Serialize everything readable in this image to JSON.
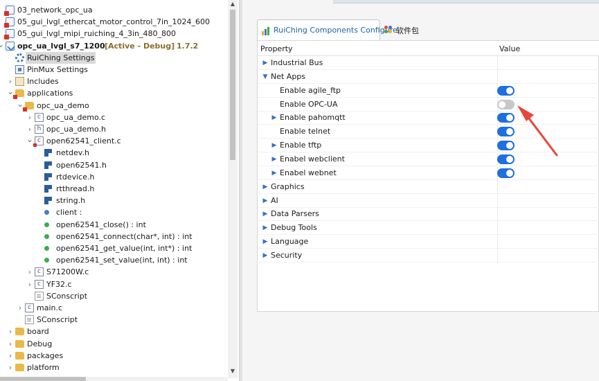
{
  "tree": [
    {
      "label": "03_network_opc_ua",
      "depth": 0,
      "expander": "",
      "icon": "projr"
    },
    {
      "label": "05_gui_lvgl_ethercat_motor_control_7in_1024_600",
      "depth": 0,
      "expander": "",
      "icon": "projr"
    },
    {
      "label": "05_gui_lvgl_mipi_ruiching_4_3in_480_800",
      "depth": 0,
      "expander": "",
      "icon": "projr"
    },
    {
      "label": "opc_ua_lvgl_s7_1200",
      "depth": 0,
      "expander": "open",
      "icon": "proj",
      "bold": true,
      "badge": "[Active - Debug]",
      "version": "1.7.2"
    },
    {
      "label": "RuiChing Settings",
      "depth": 1,
      "expander": "",
      "icon": "gear",
      "selected": true
    },
    {
      "label": "PinMux Settings",
      "depth": 1,
      "expander": "",
      "icon": "chip"
    },
    {
      "label": "Includes",
      "depth": 1,
      "expander": "closed",
      "icon": "inc"
    },
    {
      "label": "applications",
      "depth": 1,
      "expander": "open",
      "icon": "folderr"
    },
    {
      "label": "opc_ua_demo",
      "depth": 2,
      "expander": "open",
      "icon": "folderr"
    },
    {
      "label": "opc_ua_demo.c",
      "depth": 3,
      "expander": "closed",
      "icon": "file",
      "glyph": "c"
    },
    {
      "label": "opc_ua_demo.h",
      "depth": 3,
      "expander": "closed",
      "icon": "file",
      "glyph": "h"
    },
    {
      "label": "open62541_client.c",
      "depth": 3,
      "expander": "open",
      "icon": "filer",
      "glyph": "c"
    },
    {
      "label": "netdev.h",
      "depth": 4,
      "expander": "",
      "icon": "hdr"
    },
    {
      "label": "open62541.h",
      "depth": 4,
      "expander": "",
      "icon": "hdr"
    },
    {
      "label": "rtdevice.h",
      "depth": 4,
      "expander": "",
      "icon": "hdr"
    },
    {
      "label": "rtthread.h",
      "depth": 4,
      "expander": "",
      "icon": "hdr"
    },
    {
      "label": "string.h",
      "depth": 4,
      "expander": "",
      "icon": "hdr"
    },
    {
      "label": "client :",
      "depth": 4,
      "expander": "",
      "icon": "var"
    },
    {
      "label": "open62541_close() : int",
      "depth": 4,
      "expander": "",
      "icon": "fn"
    },
    {
      "label": "open62541_connect(char*, int) : int",
      "depth": 4,
      "expander": "",
      "icon": "fn"
    },
    {
      "label": "open62541_get_value(int, int*) : int",
      "depth": 4,
      "expander": "",
      "icon": "fn"
    },
    {
      "label": "open62541_set_value(int, int) : int",
      "depth": 4,
      "expander": "",
      "icon": "fn"
    },
    {
      "label": "S71200W.c",
      "depth": 3,
      "expander": "closed",
      "icon": "file",
      "glyph": "c"
    },
    {
      "label": "YF32.c",
      "depth": 3,
      "expander": "closed",
      "icon": "file",
      "glyph": "c"
    },
    {
      "label": "SConscript",
      "depth": 3,
      "expander": "",
      "icon": "doc"
    },
    {
      "label": "main.c",
      "depth": 2,
      "expander": "closed",
      "icon": "file",
      "glyph": "c"
    },
    {
      "label": "SConscript",
      "depth": 2,
      "expander": "",
      "icon": "doc"
    },
    {
      "label": "board",
      "depth": 1,
      "expander": "closed",
      "icon": "folder"
    },
    {
      "label": "Debug",
      "depth": 1,
      "expander": "closed",
      "icon": "folder"
    },
    {
      "label": "packages",
      "depth": 1,
      "expander": "closed",
      "icon": "folder"
    },
    {
      "label": "platform",
      "depth": 1,
      "expander": "closed",
      "icon": "folder"
    }
  ],
  "editor": {
    "tab_active": "RuiChing Components Configure",
    "tab_packages": "软件包",
    "col_property": "Property",
    "col_value": "Value"
  },
  "properties": [
    {
      "label": "Industrial Bus",
      "depth": 0,
      "expander": "closed"
    },
    {
      "label": "Net Apps",
      "depth": 0,
      "expander": "open"
    },
    {
      "label": "Enable agile_ftp",
      "depth": 1,
      "expander": "",
      "toggle": true
    },
    {
      "label": "Enable OPC-UA",
      "depth": 1,
      "expander": "",
      "toggle": false
    },
    {
      "label": "Enable pahomqtt",
      "depth": 1,
      "expander": "closed",
      "toggle": true
    },
    {
      "label": "Enable telnet",
      "depth": 1,
      "expander": "",
      "toggle": true
    },
    {
      "label": "Enable tftp",
      "depth": 1,
      "expander": "closed",
      "toggle": true
    },
    {
      "label": "Enabel webclient",
      "depth": 1,
      "expander": "closed",
      "toggle": true
    },
    {
      "label": "Enabel webnet",
      "depth": 1,
      "expander": "closed",
      "toggle": true
    },
    {
      "label": "Graphics",
      "depth": 0,
      "expander": "closed"
    },
    {
      "label": "AI",
      "depth": 0,
      "expander": "closed"
    },
    {
      "label": "Data Parsers",
      "depth": 0,
      "expander": "closed"
    },
    {
      "label": "Debug Tools",
      "depth": 0,
      "expander": "closed"
    },
    {
      "label": "Language",
      "depth": 0,
      "expander": "closed"
    },
    {
      "label": "Security",
      "depth": 0,
      "expander": "closed"
    }
  ],
  "colors": {
    "toggle_on": "#1e6fe0",
    "toggle_off": "#c7c7c7",
    "annotation_arrow": "#e8453c",
    "badge_text": "#8a6d2f"
  }
}
